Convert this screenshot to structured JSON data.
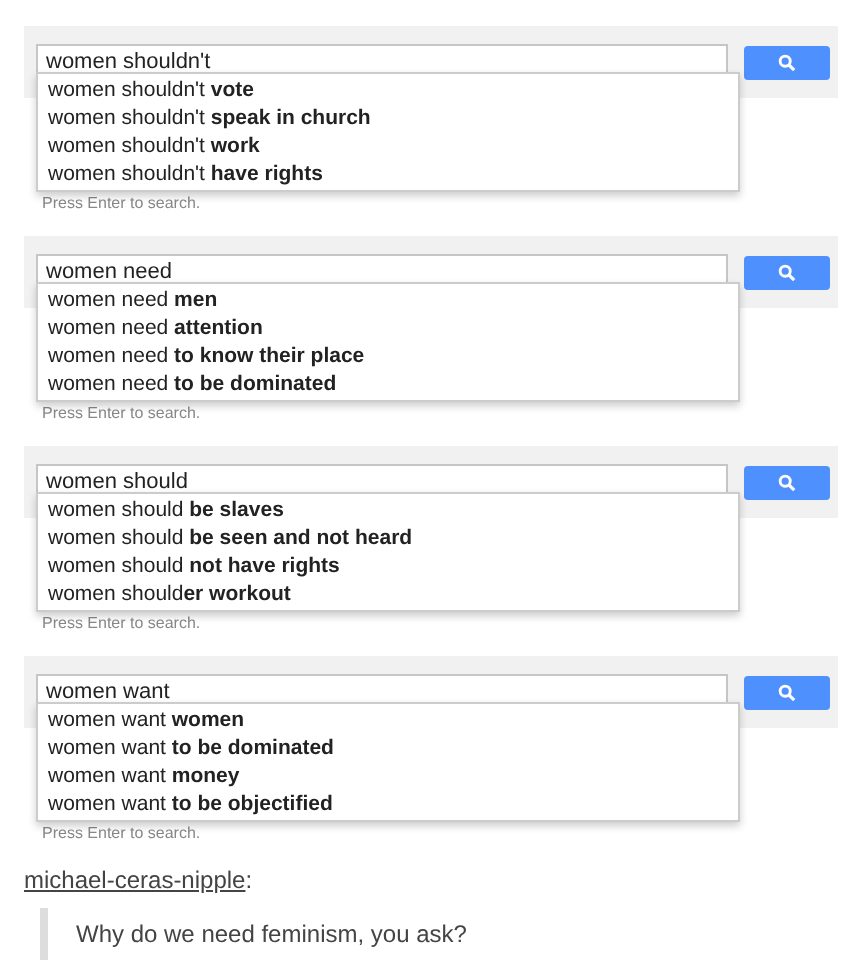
{
  "searches": [
    {
      "query": "women shouldn't",
      "suggestions": [
        "women shouldn't **vote**",
        "women shouldn't **speak in church**",
        "women shouldn't **work**",
        "women shouldn't **have rights**"
      ],
      "hint": "Press Enter to search."
    },
    {
      "query": "women need",
      "suggestions": [
        "women need **men**",
        "women need **attention**",
        "women need **to know their place**",
        "women need **to be dominated**"
      ],
      "hint": "Press Enter to search."
    },
    {
      "query": "women should",
      "suggestions": [
        "women should **be slaves**",
        "women should **be seen and not heard**",
        "women should **not have rights**",
        "women should**er workout**"
      ],
      "hint": "Press Enter to search."
    },
    {
      "query": "women want",
      "suggestions": [
        "women want **women**",
        "women want **to be dominated**",
        "women want **money**",
        "women want **to be objectified**"
      ],
      "hint": "Press Enter to search."
    }
  ],
  "post": {
    "author": "michael-ceras-nipple",
    "separator": ":",
    "quote": "Why do we need feminism, you ask?"
  }
}
